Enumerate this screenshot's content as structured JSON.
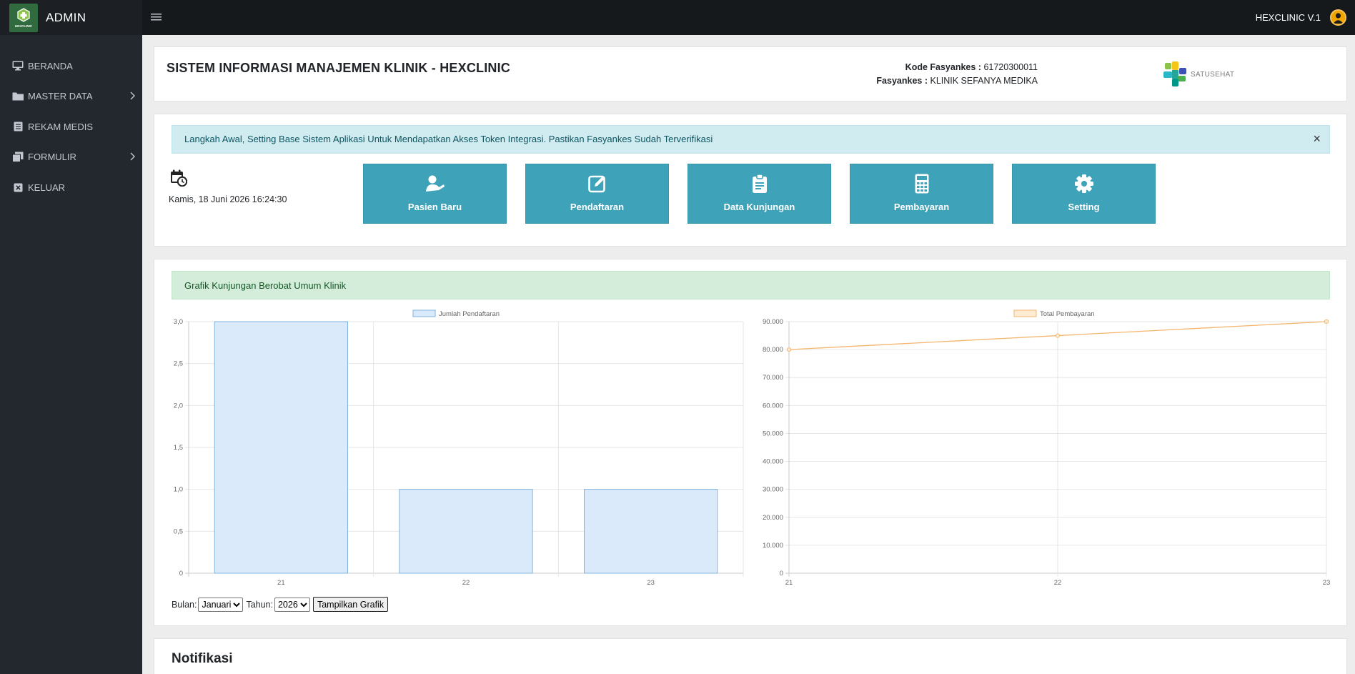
{
  "sidebar": {
    "brand": {
      "logo_text": "HEXCLINIC",
      "name": "ADMIN"
    },
    "items": [
      {
        "label": "BERANDA",
        "icon": "monitor-icon",
        "has_submenu": false
      },
      {
        "label": "MASTER DATA",
        "icon": "folder-icon",
        "has_submenu": true
      },
      {
        "label": "REKAM MEDIS",
        "icon": "list-icon",
        "has_submenu": false
      },
      {
        "label": "FORMULIR",
        "icon": "copy-icon",
        "has_submenu": true
      },
      {
        "label": "KELUAR",
        "icon": "close-box-icon",
        "has_submenu": false
      }
    ]
  },
  "topbar": {
    "app_version": "HEXCLINIC V.1"
  },
  "header": {
    "title": "SISTEM INFORMASI MANAJEMEN KLINIK - HEXCLINIC",
    "kode_label": "Kode Fasyankes :",
    "kode_value": "61720300011",
    "fasyankes_label": "Fasyankes :",
    "fasyankes_value": "KLINIK SEFANYA MEDIKA",
    "satusehat_text": "SATUSEHAT"
  },
  "alert_info": {
    "text": "Langkah Awal, Setting Base Sistem Aplikasi Untuk Mendapatkan Akses Token Integrasi. Pastikan Fasyankes Sudah Terverifikasi",
    "close": "×"
  },
  "datetime": "Kamis, 18 Juni 2026 16:24:30",
  "menu_buttons": [
    {
      "label": "Pasien Baru",
      "icon": "user-injured-icon"
    },
    {
      "label": "Pendaftaran",
      "icon": "edit-icon"
    },
    {
      "label": "Data Kunjungan",
      "icon": "clipboard-icon"
    },
    {
      "label": "Pembayaran",
      "icon": "calculator-icon"
    },
    {
      "label": "Setting",
      "icon": "gear-icon"
    }
  ],
  "chart_alert": "Grafik Kunjungan Berobat Umum Klinik",
  "filter": {
    "bulan_label": "Bulan:",
    "bulan_value": "Januari",
    "tahun_label": "Tahun:",
    "tahun_value": "2026",
    "button_label": "Tampilkan Grafik"
  },
  "notifications": {
    "title": "Notifikasi"
  },
  "colors": {
    "sidebar_bg": "#23282e",
    "topbar_bg": "#16191c",
    "button_bg": "#3ea2b8",
    "bar_fill": "#dbeafa",
    "bar_stroke": "#7fb4df",
    "line_stroke": "#f5b56c"
  },
  "chart_data": [
    {
      "type": "bar",
      "categories": [
        "21",
        "22",
        "23"
      ],
      "series": [
        {
          "name": "Jumlah Pendaftaran",
          "values": [
            3,
            1,
            1
          ]
        }
      ],
      "ylim": [
        0,
        3
      ],
      "yticks": [
        "0",
        "0,5",
        "1,0",
        "1,5",
        "2,0",
        "2,5",
        "3,0"
      ],
      "legend": "top-center",
      "grid": true
    },
    {
      "type": "line",
      "categories": [
        "21",
        "22",
        "23"
      ],
      "series": [
        {
          "name": "Total Pembayaran",
          "values": [
            80000,
            85000,
            90000
          ]
        }
      ],
      "ylim": [
        0,
        90000
      ],
      "yticks": [
        "0",
        "10.000",
        "20.000",
        "30.000",
        "40.000",
        "50.000",
        "60.000",
        "70.000",
        "80.000",
        "90.000"
      ],
      "legend": "top-center",
      "grid": true
    }
  ]
}
